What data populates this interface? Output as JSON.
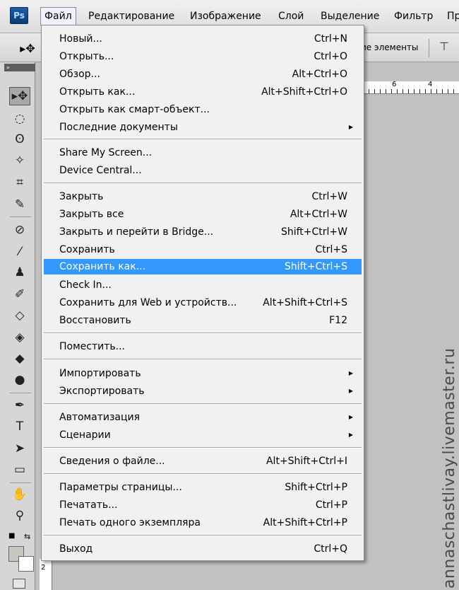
{
  "app": {
    "logo": "Ps"
  },
  "menubar": {
    "items": [
      "Файл",
      "Редактирование",
      "Изображение",
      "Слой",
      "Выделение",
      "Фильтр",
      "Пр"
    ]
  },
  "options_bar": {
    "text": "ие элементы"
  },
  "rulers": {
    "top_numbers": [
      "6",
      "4"
    ],
    "left_number": "2"
  },
  "watermark": "annaschastlivay.livemaster.ru",
  "file_menu": {
    "groups": [
      [
        {
          "label": "Новый...",
          "shortcut": "Ctrl+N"
        },
        {
          "label": "Открыть...",
          "shortcut": "Ctrl+O"
        },
        {
          "label": "Обзор...",
          "shortcut": "Alt+Ctrl+O"
        },
        {
          "label": "Открыть как...",
          "shortcut": "Alt+Shift+Ctrl+O"
        },
        {
          "label": "Открыть как смарт-объект...",
          "shortcut": ""
        },
        {
          "label": "Последние документы",
          "shortcut": "",
          "submenu": true
        }
      ],
      [
        {
          "label": "Share My Screen...",
          "shortcut": ""
        },
        {
          "label": "Device Central...",
          "shortcut": ""
        }
      ],
      [
        {
          "label": "Закрыть",
          "shortcut": "Ctrl+W"
        },
        {
          "label": "Закрыть все",
          "shortcut": "Alt+Ctrl+W"
        },
        {
          "label": "Закрыть и перейти в Bridge...",
          "shortcut": "Shift+Ctrl+W"
        },
        {
          "label": "Сохранить",
          "shortcut": "Ctrl+S"
        },
        {
          "label": "Сохранить как...",
          "shortcut": "Shift+Ctrl+S",
          "highlighted": true
        },
        {
          "label": "Check In...",
          "shortcut": ""
        },
        {
          "label": "Сохранить для Web и устройств...",
          "shortcut": "Alt+Shift+Ctrl+S"
        },
        {
          "label": "Восстановить",
          "shortcut": "F12"
        }
      ],
      [
        {
          "label": "Поместить...",
          "shortcut": ""
        }
      ],
      [
        {
          "label": "Импортировать",
          "shortcut": "",
          "submenu": true
        },
        {
          "label": "Экспортировать",
          "shortcut": "",
          "submenu": true
        }
      ],
      [
        {
          "label": "Автоматизация",
          "shortcut": "",
          "submenu": true
        },
        {
          "label": "Сценарии",
          "shortcut": "",
          "submenu": true
        }
      ],
      [
        {
          "label": "Сведения о файле...",
          "shortcut": "Alt+Shift+Ctrl+I"
        }
      ],
      [
        {
          "label": "Параметры страницы...",
          "shortcut": "Shift+Ctrl+P"
        },
        {
          "label": "Печатать...",
          "shortcut": "Ctrl+P"
        },
        {
          "label": "Печать одного экземпляра",
          "shortcut": "Alt+Shift+Ctrl+P"
        }
      ],
      [
        {
          "label": "Выход",
          "shortcut": "Ctrl+Q"
        }
      ]
    ]
  },
  "tools": [
    "move-tool-icon",
    "marquee-tool-icon",
    "lasso-tool-icon",
    "quick-select-tool-icon",
    "crop-tool-icon",
    "eyedropper-tool-icon",
    "healing-brush-tool-icon",
    "brush-tool-icon",
    "clone-stamp-tool-icon",
    "history-brush-tool-icon",
    "eraser-tool-icon",
    "paint-bucket-tool-icon",
    "blur-tool-icon",
    "dodge-tool-icon",
    "pen-tool-icon",
    "type-tool-icon",
    "path-select-tool-icon",
    "shape-tool-icon",
    "hand-tool-icon",
    "zoom-tool-icon"
  ]
}
